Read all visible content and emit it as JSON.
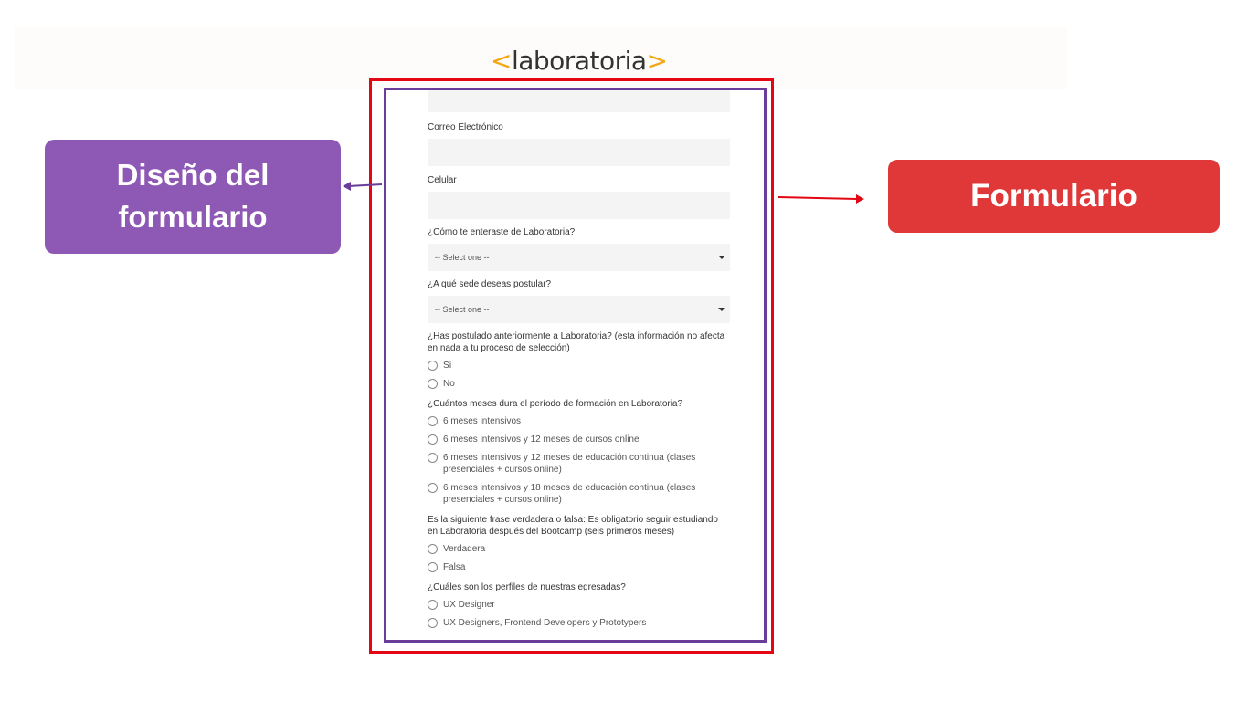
{
  "logo": {
    "open": "<",
    "text": "laboratoria",
    "close": ">"
  },
  "callouts": {
    "design": "Diseño del formulario",
    "form": "Formulario"
  },
  "form": {
    "email_label": "Correo Electrónico",
    "phone_label": "Celular",
    "how_label": "¿Cómo te enteraste de Laboratoria?",
    "how_value": "-- Select one --",
    "sede_label": "¿A qué sede deseas postular?",
    "sede_value": "-- Select one --",
    "q_prev": "¿Has postulado anteriormente a Laboratoria? (esta información no afecta en nada a tu proceso de selección)",
    "q_prev_options": [
      "Sí",
      "No"
    ],
    "q_months": "¿Cuántos meses dura el período de formación en Laboratoria?",
    "q_months_options": [
      "6 meses intensivos",
      "6 meses intensivos y 12 meses de cursos online",
      "6 meses intensivos y 12 meses de educación continua (clases presenciales + cursos online)",
      "6 meses intensivos y 18 meses de educación continua (clases presenciales + cursos online)"
    ],
    "q_true": "Es la siguiente frase verdadera o falsa: Es obligatorio seguir estudiando en Laboratoria después del Bootcamp (seis primeros meses)",
    "q_true_options": [
      "Verdadera",
      "Falsa"
    ],
    "q_profiles": "¿Cuáles son los perfiles de nuestras egresadas?",
    "q_profiles_options": [
      "UX Designer",
      "UX Designers, Frontend Developers y Prototypers"
    ]
  },
  "colors": {
    "red": "#e30613",
    "purple": "#6a3d9a",
    "accent": "#f3a712"
  }
}
